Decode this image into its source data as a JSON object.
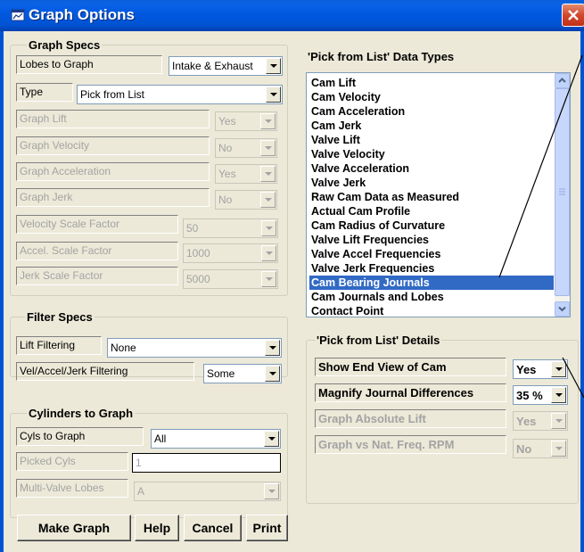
{
  "window": {
    "title": "Graph Options"
  },
  "graph_specs": {
    "title": "Graph Specs",
    "lobes_label": "Lobes to Graph",
    "lobes_value": "Intake & Exhaust",
    "type_label": "Type",
    "type_value": "Pick from List",
    "lift_label": "Graph Lift",
    "lift_value": "Yes",
    "velocity_label": "Graph Velocity",
    "velocity_value": "No",
    "accel_label": "Graph Acceleration",
    "accel_value": "Yes",
    "jerk_label": "Graph Jerk",
    "jerk_value": "No",
    "vel_scale_label": "Velocity Scale Factor",
    "vel_scale_value": "50",
    "accel_scale_label": "Accel. Scale Factor",
    "accel_scale_value": "1000",
    "jerk_scale_label": "Jerk Scale Factor",
    "jerk_scale_value": "5000"
  },
  "filter_specs": {
    "title": "Filter Specs",
    "lift_label": "Lift Filtering",
    "lift_value": "None",
    "vaj_label": "Vel/Accel/Jerk Filtering",
    "vaj_value": "Some"
  },
  "cylinders": {
    "title": "Cylinders to Graph",
    "cyls_label": "Cyls to Graph",
    "cyls_value": "All",
    "picked_label": "Picked Cyls",
    "picked_value": "1",
    "multivalve_label": "Multi-Valve Lobes",
    "multivalve_value": "A"
  },
  "data_types": {
    "heading": "'Pick from List' Data Types",
    "items": [
      "Cam Lift",
      "Cam Velocity",
      "Cam Acceleration",
      "Cam Jerk",
      "Valve Lift",
      "Valve Velocity",
      "Valve Acceleration",
      "Valve Jerk",
      "Raw Cam Data as Measured",
      "Actual Cam Profile",
      "Cam Radius of Curvature",
      "Valve Lift Frequencies",
      "Valve Accel Frequencies",
      "Valve Jerk Frequencies",
      "Cam Bearing Journals",
      "Cam Journals and Lobes",
      "Contact Point"
    ],
    "selected": "Cam Bearing Journals"
  },
  "details": {
    "title": "'Pick from List' Details",
    "end_view_label": "Show End View of Cam",
    "end_view_value": "Yes",
    "magnify_label": "Magnify Journal Differences",
    "magnify_value": "35 %",
    "abs_lift_label": "Graph Absolute Lift",
    "abs_lift_value": "Yes",
    "nat_freq_label": "Graph vs Nat. Freq. RPM",
    "nat_freq_value": "No"
  },
  "buttons": {
    "make_graph": "Make Graph",
    "help": "Help",
    "cancel": "Cancel",
    "print": "Print"
  },
  "colors": {
    "titlebar": "#0053d2",
    "dialog_bg": "#ece9d8",
    "selection": "#316ac5",
    "close_red": "#d2482b"
  }
}
